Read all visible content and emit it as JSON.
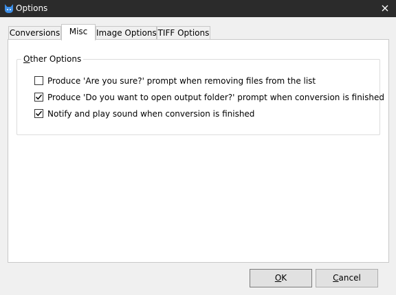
{
  "window": {
    "title": "Options",
    "app_icon": "cat-logo-icon",
    "close_icon": "close-icon"
  },
  "tabs": [
    {
      "label": "Conversions",
      "active": false
    },
    {
      "label": "Misc",
      "active": true
    },
    {
      "label": "Image Options",
      "active": false
    },
    {
      "label": "TIFF Options",
      "active": false
    }
  ],
  "group": {
    "legend_accel": "O",
    "legend_rest": "ther Options"
  },
  "options": [
    {
      "label": "Produce 'Are you sure?' prompt when removing files from the list",
      "checked": false
    },
    {
      "label": "Produce 'Do you want to open output folder?' prompt when conversion is finished",
      "checked": true
    },
    {
      "label": "Notify and play sound when conversion is finished",
      "checked": true
    }
  ],
  "buttons": {
    "ok_accel": "O",
    "ok_rest": "K",
    "cancel_accel": "C",
    "cancel_rest": "ancel"
  },
  "colors": {
    "titlebar": "#2b2b2b",
    "icon_blue": "#3d8ee6"
  }
}
